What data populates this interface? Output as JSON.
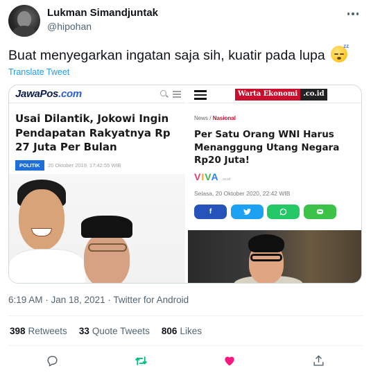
{
  "author": {
    "display_name": "Lukman Simandjuntak",
    "handle": "@hipohan"
  },
  "tweet": {
    "text": "Buat menyegarkan ingatan saja sih, kuatir pada lupa",
    "emoji": "sleeping-face",
    "translate_label": "Translate Tweet"
  },
  "media": {
    "left": {
      "logo_main": "JawaPos",
      "logo_suffix": ".com",
      "headline": "Usai Dilantik, Jokowi Ingin Pendapatan Rakyatnya Rp 27 Juta Per Bulan",
      "tag": "POLITIK",
      "date": "20 Oktober 2019, 17:42:55 WIB"
    },
    "right": {
      "logo_main": "Warta Ekonomi",
      "logo_suffix": ".co.id",
      "breadcrumb_home": "News",
      "breadcrumb_sep": " / ",
      "breadcrumb_section": "Nasional",
      "headline": "Per Satu Orang WNI Harus Menanggung Utang Negara Rp20 Juta!",
      "source_logo": "VIVA",
      "source_logo_suffix": ".co.id",
      "date": "Selasa, 20 Oktober 2020, 22:42 WIB",
      "share_buttons": [
        "f",
        "t",
        "w",
        "l"
      ]
    }
  },
  "meta": {
    "time": "6:19 AM",
    "date": "Jan 18, 2021",
    "client": "Twitter for Android",
    "separator": " · "
  },
  "stats": {
    "retweets_count": "398",
    "retweets_label": "Retweets",
    "quotes_count": "33",
    "quotes_label": "Quote Tweets",
    "likes_count": "806",
    "likes_label": "Likes"
  },
  "colors": {
    "accent": "#1d9bf0",
    "like": "#f91880",
    "retweet": "#00ba7c",
    "muted": "#536471"
  },
  "icons": {
    "reply": "reply-icon",
    "retweet": "retweet-icon",
    "like": "heart-icon",
    "share": "share-icon",
    "more": "more-icon"
  }
}
